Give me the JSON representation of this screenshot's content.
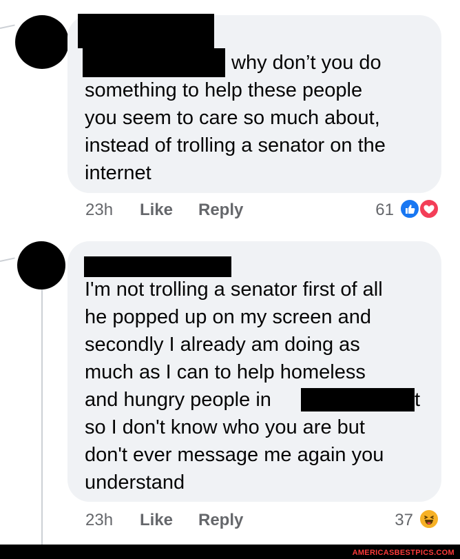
{
  "comments": [
    {
      "text_first_line": "why don’t you do",
      "text_rest": "something to help these people\nyou seem to care so much about,\ninstead of trolling a senator on the\ninternet",
      "time": "23h",
      "like_label": "Like",
      "reply_label": "Reply",
      "reaction_count": "61",
      "reactions": [
        "like-reaction-icon",
        "love-reaction-icon"
      ]
    },
    {
      "text": "I'm not trolling a senator first of all\nhe popped up on my screen and\nsecondly I already am doing as\nmuch as I can to help homeless\nand hungry people in",
      "text_line5_tail": "t",
      "text_rest": "so I don't know who you are but\ndon't ever message me again you\nunderstand",
      "time": "23h",
      "like_label": "Like",
      "reply_label": "Reply",
      "reaction_count": "37",
      "reactions": [
        "haha-reaction-icon"
      ]
    }
  ],
  "colors": {
    "bubble": "#f0f2f5",
    "meta": "#65676b",
    "like_blue": "#1877f2",
    "love_red": "#f33e58",
    "haha_yellow": "#f7b125"
  },
  "footer": {
    "brand": "AMERICASBESTPICS.COM"
  }
}
